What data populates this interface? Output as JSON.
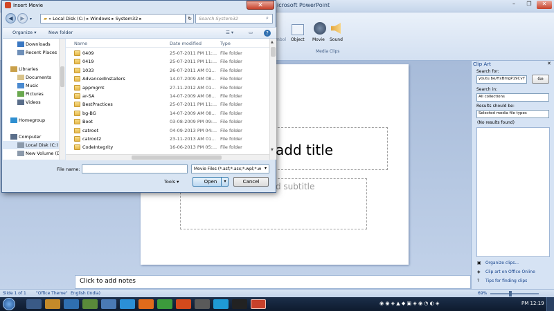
{
  "powerpoint": {
    "title_fragment": "icrosoft PowerPoint",
    "ribbon": {
      "items": [
        "mbol",
        "Object",
        "Movie",
        "Sound"
      ],
      "group_label": "Media Clips"
    },
    "slide": {
      "title_placeholder": "add title",
      "subtitle_placeholder": "d subtitle"
    },
    "notes_placeholder": "Click to add notes"
  },
  "clip_art": {
    "title": "Clip Art",
    "search_label": "Search for:",
    "search_value": "youtu.be/HxBmgP19CvY",
    "go_label": "Go",
    "search_in_label": "Search in:",
    "search_in_value": "All collections",
    "results_label": "Results should be:",
    "results_value": "Selected media file types",
    "no_results": "(No results found)",
    "links": [
      "Organize clips...",
      "Clip art on Office Online",
      "Tips for finding clips"
    ]
  },
  "status_bar": {
    "slide": "Slide 1 of 1",
    "theme": "\"Office Theme\"",
    "language": "English (India)",
    "zoom": "69%"
  },
  "taskbar": {
    "clock": "PM 12:19"
  },
  "dialog": {
    "title": "Insert Movie",
    "breadcrumb": [
      "Local Disk (C:)",
      "Windows",
      "System32"
    ],
    "search_placeholder": "Search System32",
    "toolbar": {
      "organize": "Organize",
      "new_folder": "New folder"
    },
    "nav": [
      {
        "label": "Downloads",
        "icon": "downloads-icon"
      },
      {
        "label": "Recent Places",
        "icon": "recent-places-icon"
      },
      {
        "label": "Libraries",
        "icon": "libraries-icon"
      },
      {
        "label": "Documents",
        "icon": "documents-icon"
      },
      {
        "label": "Music",
        "icon": "music-icon"
      },
      {
        "label": "Pictures",
        "icon": "pictures-icon"
      },
      {
        "label": "Videos",
        "icon": "videos-icon"
      },
      {
        "label": "Homegroup",
        "icon": "homegroup-icon"
      },
      {
        "label": "Computer",
        "icon": "computer-icon"
      },
      {
        "label": "Local Disk (C:)",
        "icon": "drive-icon"
      },
      {
        "label": "New Volume (D",
        "icon": "drive-icon"
      }
    ],
    "columns": [
      "Name",
      "Date modified",
      "Type"
    ],
    "files": [
      {
        "name": "0409",
        "date": "25-07-2011 PM 11:...",
        "type": "File folder"
      },
      {
        "name": "0419",
        "date": "25-07-2011 PM 11:...",
        "type": "File folder"
      },
      {
        "name": "1033",
        "date": "26-07-2011 AM 01...",
        "type": "File folder"
      },
      {
        "name": "AdvancedInstallers",
        "date": "14-07-2009 AM 08...",
        "type": "File folder"
      },
      {
        "name": "appmgmt",
        "date": "27-11-2012 AM 01...",
        "type": "File folder"
      },
      {
        "name": "ar-SA",
        "date": "14-07-2009 AM 08...",
        "type": "File folder"
      },
      {
        "name": "BestPractices",
        "date": "25-07-2011 PM 11:...",
        "type": "File folder"
      },
      {
        "name": "bg-BG",
        "date": "14-07-2009 AM 08...",
        "type": "File folder"
      },
      {
        "name": "Boot",
        "date": "03-08-2009 PM 09:...",
        "type": "File folder"
      },
      {
        "name": "catroot",
        "date": "04-09-2013 PM 04:...",
        "type": "File folder"
      },
      {
        "name": "catroot2",
        "date": "23-11-2013 AM 01...",
        "type": "File folder"
      },
      {
        "name": "CodeIntegrity",
        "date": "16-06-2013 PM 05:...",
        "type": "File folder"
      }
    ],
    "file_name_label": "File name:",
    "file_name_value": "",
    "file_type": "Movie Files (*.asf;*.asx;*.wpl;*.w",
    "tools": "Tools",
    "open": "Open",
    "cancel": "Cancel"
  }
}
